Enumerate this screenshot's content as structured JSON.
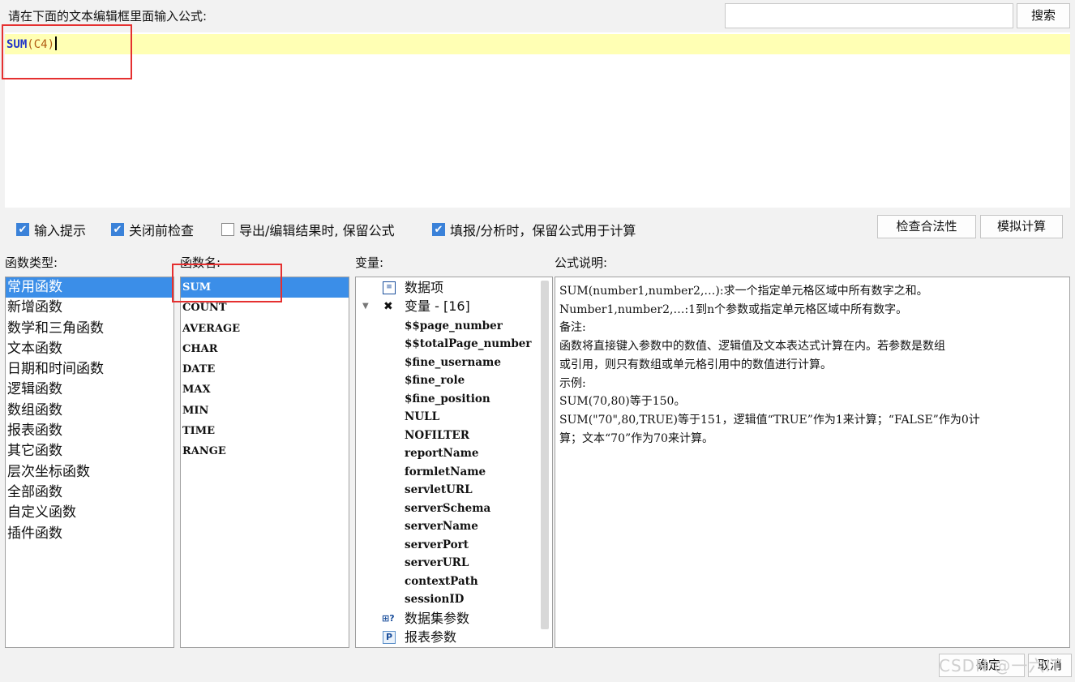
{
  "prompt": "请在下面的文本编辑框里面输入公式:",
  "search": {
    "placeholder": "",
    "button_label": "搜索"
  },
  "editor": {
    "formula_fn": "SUM",
    "formula_open": "(",
    "formula_arg": "C4",
    "formula_close": ")"
  },
  "options": {
    "input_hint": {
      "label": "输入提示",
      "checked": true
    },
    "check_before_close": {
      "label": "关闭前检查",
      "checked": true
    },
    "keep_formula_export": {
      "label": "导出/编辑结果时, 保留公式",
      "checked": false
    },
    "keep_formula_fill": {
      "label": "填报/分析时，保留公式用于计算",
      "checked": true
    }
  },
  "buttons": {
    "check_validity": "检查合法性",
    "simulate": "模拟计算",
    "ok": "确定",
    "cancel": "取消"
  },
  "headers": {
    "categories": "函数类型:",
    "functions": "函数名:",
    "variables": "变量:",
    "description": "公式说明:"
  },
  "categories": [
    "常用函数",
    "新增函数",
    "数学和三角函数",
    "文本函数",
    "日期和时间函数",
    "逻辑函数",
    "数组函数",
    "报表函数",
    "其它函数",
    "层次坐标函数",
    "全部函数",
    "自定义函数",
    "插件函数"
  ],
  "selected_category": 0,
  "functions": [
    "SUM",
    "COUNT",
    "AVERAGE",
    "CHAR",
    "DATE",
    "MAX",
    "MIN",
    "TIME",
    "RANGE"
  ],
  "selected_function": 0,
  "variables": {
    "data_items": "数据项",
    "var_group": "变量 - [16]",
    "items": [
      "$$page_number",
      "$$totalPage_number",
      "$fine_username",
      "$fine_role",
      "$fine_position",
      "NULL",
      "NOFILTER",
      "reportName",
      "formletName",
      "servletURL",
      "serverSchema",
      "serverName",
      "serverPort",
      "serverURL",
      "contextPath",
      "sessionID"
    ],
    "dataset_params": "数据集参数",
    "report_params": "报表参数"
  },
  "description": [
    "SUM(number1,number2,…):求一个指定单元格区域中所有数字之和。",
    "Number1,number2,…:1到n个参数或指定单元格区域中所有数字。",
    "备注:",
    "函数将直接键入参数中的数值、逻辑值及文本表达式计算在内。若参数是数组",
    "或引用，则只有数组或单元格引用中的数值进行计算。",
    "示例:",
    "SUM(70,80)等于150。",
    "SUM(\"70\",80,TRUE)等于151，逻辑值“TRUE”作为1来计算；“FALSE”作为0计",
    "算；文本“70”作为70来计算。"
  ],
  "watermark": "CSDN @一六IT",
  "colors": {
    "selection": "#3b8ee8",
    "highlight_line": "#ffffb4",
    "annotation": "#e53030",
    "checkbox": "#3b82d9"
  }
}
